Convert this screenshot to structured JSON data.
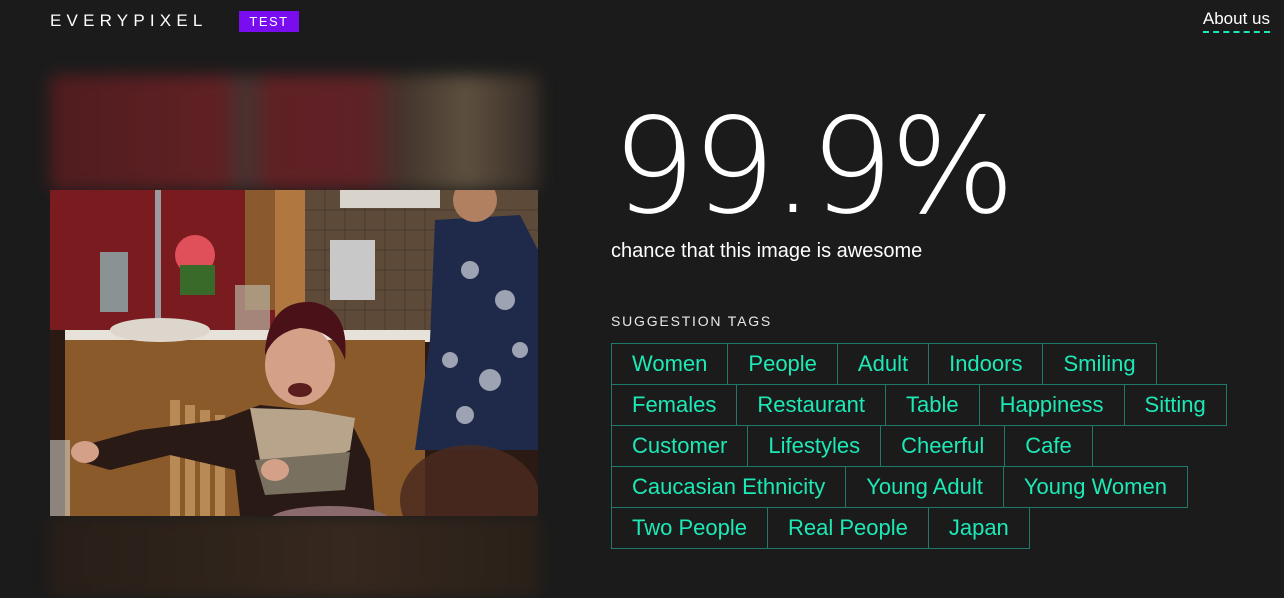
{
  "header": {
    "logo": "EVERYPIXEL",
    "badge": "TEST",
    "about_link": "About us",
    "accent_color": "#1de9b6",
    "badge_color": "#7a0cf0"
  },
  "result": {
    "score": "99.9%",
    "subtitle": "chance that this image is awesome"
  },
  "photo": {
    "description": "Smiling woman with short red hair in a patterned sweater seated at a table in a kitchen; another woman in a floral dress stands in the background"
  },
  "tags": {
    "title": "SUGGESTION TAGS",
    "rows": [
      [
        "Women",
        "People",
        "Adult",
        "Indoors",
        "Smiling"
      ],
      [
        "Females",
        "Restaurant",
        "Table",
        "Happiness",
        "Sitting"
      ],
      [
        "Customer",
        "Lifestyles",
        "Cheerful",
        "Cafe"
      ],
      [
        "Caucasian Ethnicity",
        "Young Adult",
        "Young Women"
      ],
      [
        "Two People",
        "Real People",
        "Japan"
      ]
    ]
  }
}
